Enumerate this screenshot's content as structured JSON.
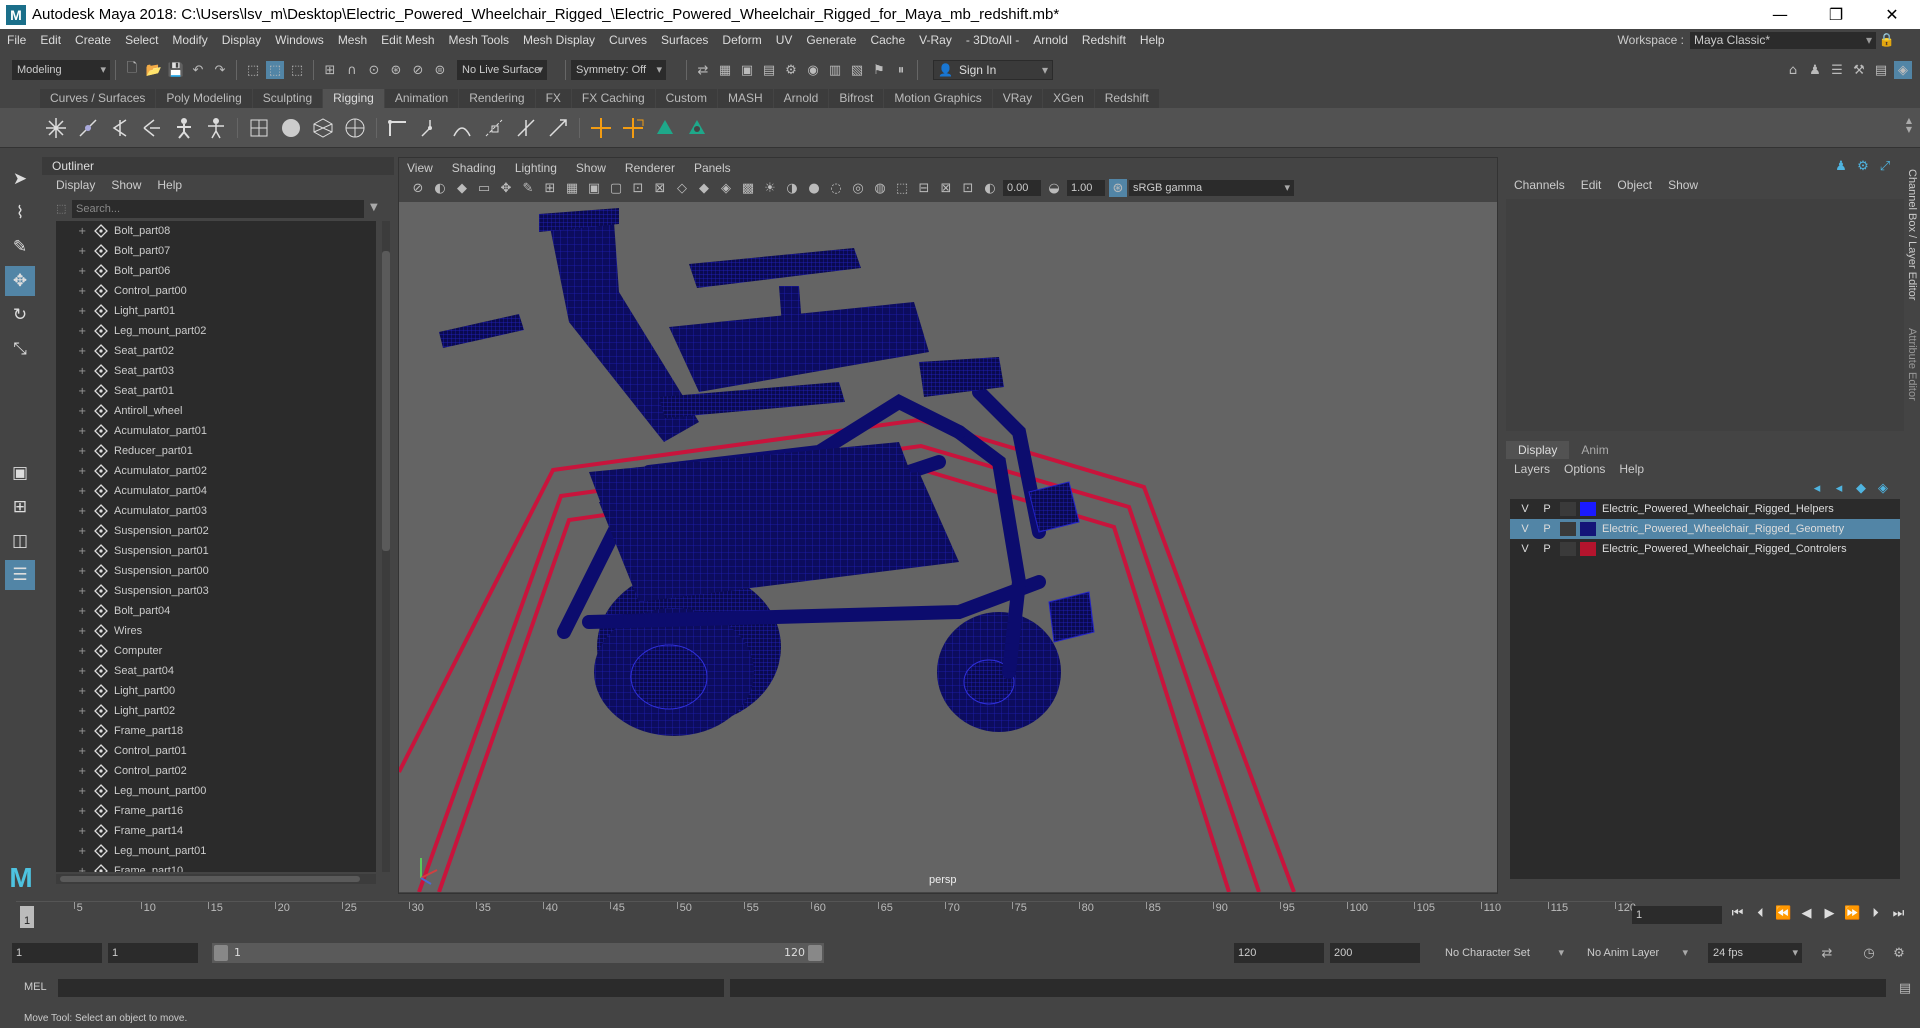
{
  "window": {
    "title": "Autodesk Maya 2018: C:\\Users\\lsv_m\\Desktop\\Electric_Powered_Wheelchair_Rigged_\\Electric_Powered_Wheelchair_Rigged_for_Maya_mb_redshift.mb*",
    "logo": "M"
  },
  "menubar": {
    "items": [
      "File",
      "Edit",
      "Create",
      "Select",
      "Modify",
      "Display",
      "Windows",
      "Mesh",
      "Edit Mesh",
      "Mesh Tools",
      "Mesh Display",
      "Curves",
      "Surfaces",
      "Deform",
      "UV",
      "Generate",
      "Cache",
      "V-Ray",
      "- 3DtoAll -",
      "Arnold",
      "Redshift",
      "Help"
    ],
    "workspace_label": "Workspace :",
    "workspace_value": "Maya Classic*"
  },
  "statusline": {
    "mode": "Modeling",
    "live_surface": "No Live Surface",
    "symmetry": "Symmetry: Off",
    "sign_in": "Sign In"
  },
  "shelf": {
    "tabs": [
      "Curves / Surfaces",
      "Poly Modeling",
      "Sculpting",
      "Rigging",
      "Animation",
      "Rendering",
      "FX",
      "FX Caching",
      "Custom",
      "MASH",
      "Arnold",
      "Bifrost",
      "Motion Graphics",
      "VRay",
      "XGen",
      "Redshift"
    ],
    "active_tab": "Rigging"
  },
  "outliner": {
    "title": "Outliner",
    "menu": [
      "Display",
      "Show",
      "Help"
    ],
    "search_placeholder": "Search...",
    "items": [
      "Bolt_part08",
      "Bolt_part07",
      "Bolt_part06",
      "Control_part00",
      "Light_part01",
      "Leg_mount_part02",
      "Seat_part02",
      "Seat_part03",
      "Seat_part01",
      "Antiroll_wheel",
      "Acumulator_part01",
      "Reducer_part01",
      "Acumulator_part02",
      "Acumulator_part04",
      "Acumulator_part03",
      "Suspension_part02",
      "Suspension_part01",
      "Suspension_part00",
      "Suspension_part03",
      "Bolt_part04",
      "Wires",
      "Computer",
      "Seat_part04",
      "Light_part00",
      "Light_part02",
      "Frame_part18",
      "Control_part01",
      "Control_part02",
      "Leg_mount_part00",
      "Frame_part16",
      "Frame_part14",
      "Leg_mount_part01",
      "Frame_part10"
    ]
  },
  "viewport": {
    "menu": [
      "View",
      "Shading",
      "Lighting",
      "Show",
      "Renderer",
      "Panels"
    ],
    "exposure": "0.00",
    "gamma_value": "1.00",
    "color_space": "sRGB gamma",
    "camera_label": "persp",
    "wire_color": "#0a0a8c",
    "control_color": "#c8143c"
  },
  "channelbox": {
    "menu": [
      "Channels",
      "Edit",
      "Object",
      "Show"
    ],
    "tabs": [
      "Display",
      "Anim"
    ],
    "active_tab": "Display",
    "layer_menu": [
      "Layers",
      "Options",
      "Help"
    ],
    "layers": [
      {
        "v": "V",
        "p": "P",
        "color": "#1a1aff",
        "name": "Electric_Powered_Wheelchair_Rigged_Helpers",
        "selected": false
      },
      {
        "v": "V",
        "p": "P",
        "color": "#141478",
        "name": "Electric_Powered_Wheelchair_Rigged_Geometry",
        "selected": true
      },
      {
        "v": "V",
        "p": "P",
        "color": "#b4142d",
        "name": "Electric_Powered_Wheelchair_Rigged_Controlers",
        "selected": false
      }
    ],
    "side_tabs": [
      "Channel Box / Layer Editor",
      "Attribute Editor"
    ]
  },
  "timeline": {
    "ticks": [
      5,
      10,
      15,
      20,
      25,
      30,
      35,
      40,
      45,
      50,
      55,
      60,
      65,
      70,
      75,
      80,
      85,
      90,
      95,
      100,
      105,
      110,
      115,
      120
    ],
    "current_frame": "1",
    "frame_field": "1"
  },
  "range": {
    "start": "1",
    "playback_start": "1",
    "slider_start": "1",
    "slider_end": "120",
    "playback_end": "120",
    "end": "200",
    "character_set": "No Character Set",
    "anim_layer": "No Anim Layer",
    "fps": "24 fps"
  },
  "cmdline": {
    "label": "MEL"
  },
  "helpline": {
    "text": "Move Tool: Select an object to move."
  }
}
